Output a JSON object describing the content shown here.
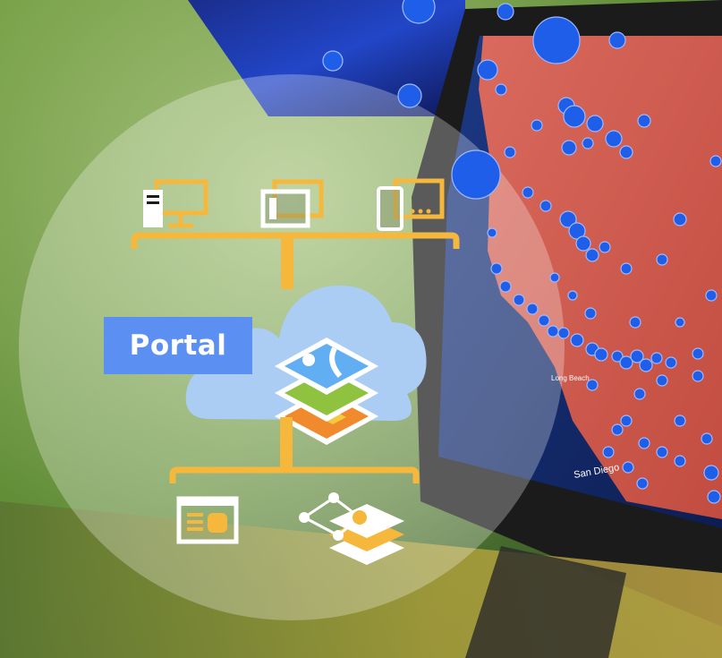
{
  "portal": {
    "label": "Portal"
  },
  "map": {
    "place_labels": [
      "Long Beach",
      "San Diego"
    ]
  },
  "colors": {
    "accent": "#f5b83d",
    "portal_blue": "#5b8ff1",
    "cloud_blue": "#6aa6e8",
    "map_red": "#d95a4e",
    "point_blue": "#1f5ee8"
  },
  "icons": {
    "top_row": [
      "desktop-computer-icon",
      "tablet-web-icon",
      "mobile-devices-icon"
    ],
    "center": "map-layers-icon",
    "bottom_row": [
      "database-server-icon",
      "network-analysis-icon"
    ]
  }
}
